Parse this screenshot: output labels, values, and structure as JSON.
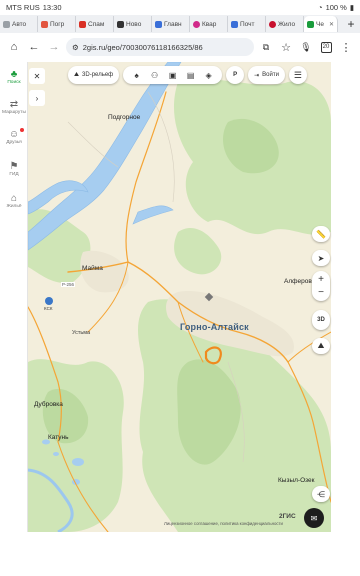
{
  "status": {
    "carrier": "MTS RUS",
    "time": "13:30",
    "battery": "100 %"
  },
  "tabs": [
    {
      "label": "Авто",
      "color": "#9aa0a6"
    },
    {
      "label": "Погр",
      "color": "#e2553f"
    },
    {
      "label": "Спам",
      "color": "#d93025"
    },
    {
      "label": "Ново",
      "color": "#333333"
    },
    {
      "label": "Главн",
      "color": "#3a6fd8"
    },
    {
      "label": "Квар",
      "color": "#d12a8a"
    },
    {
      "label": "Почт",
      "color": "#3a6fd8"
    },
    {
      "label": "Жило",
      "color": "#c8102e"
    },
    {
      "label": "Че",
      "color": "#1a9c3c"
    }
  ],
  "browser": {
    "url": "2gis.ru/geo/70030076118166325/86",
    "tab_count": "20"
  },
  "sidebar": {
    "items": [
      {
        "label": "Поиск",
        "icon": "tree-icon"
      },
      {
        "label": "Маршруты",
        "icon": "route-icon"
      },
      {
        "label": "Друзья",
        "icon": "friends-icon"
      },
      {
        "label": "ГИД",
        "icon": "flag-icon"
      },
      {
        "label": "Жильё",
        "icon": "house-icon"
      }
    ]
  },
  "toolbar": {
    "relief_label": "3D-рельеф",
    "login_label": "Войти",
    "parking_label": "P"
  },
  "map": {
    "places": {
      "podgornoe": "Подгорное",
      "maima": "Майма",
      "ust_muny": "Устьма",
      "gorno_altaysk": "Горно-Алтайск",
      "alferovo": "Алферово",
      "dubrovka": "Дубровка",
      "katun": "Катунь",
      "kyzyl_ozek": "Кызыл-Озек",
      "road_r256": "Р-256",
      "ksk": "КСК"
    },
    "controls": {
      "three_d": "3D"
    },
    "brand": "2ГИС",
    "legal": "Лицензионное соглашение, политика конфиденциальности"
  }
}
